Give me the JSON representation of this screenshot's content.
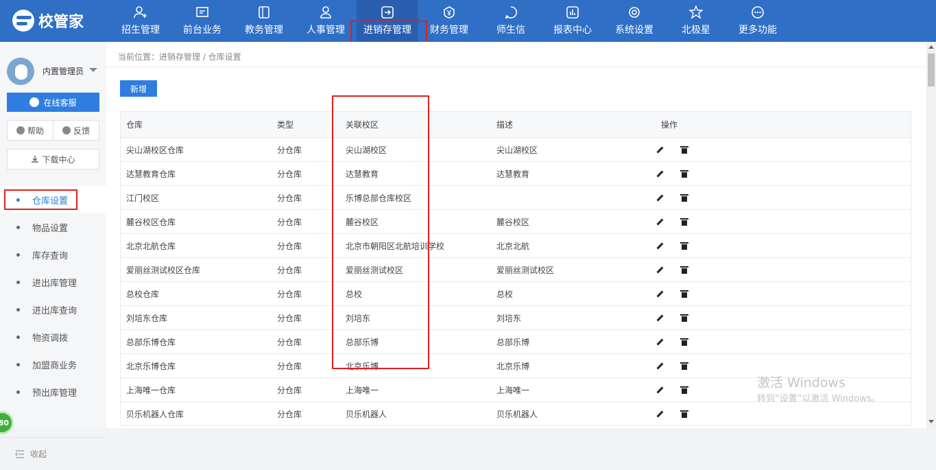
{
  "app": {
    "logo_text": "校管家"
  },
  "nav": [
    {
      "label": "招生管理",
      "icon": "user-plus-icon"
    },
    {
      "label": "前台业务",
      "icon": "monitor-icon"
    },
    {
      "label": "教务管理",
      "icon": "book-icon"
    },
    {
      "label": "人事管理",
      "icon": "person-icon"
    },
    {
      "label": "进销存管理",
      "icon": "arrow-box-icon",
      "active": true
    },
    {
      "label": "财务管理",
      "icon": "yen-shield-icon"
    },
    {
      "label": "师生信",
      "icon": "message-icon"
    },
    {
      "label": "报表中心",
      "icon": "bar-report-icon"
    },
    {
      "label": "系统设置",
      "icon": "gear-icon"
    },
    {
      "label": "北极星",
      "icon": "star-icon"
    },
    {
      "label": "更多功能",
      "icon": "more-icon"
    }
  ],
  "sidebar": {
    "user_name": "内置管理员",
    "online_service": "在线客服",
    "help": "帮助",
    "feedback": "反馈",
    "download": "下载中心",
    "menu": [
      "仓库设置",
      "物品设置",
      "库存查询",
      "进出库管理",
      "进出库查询",
      "物资调拨",
      "加盟商业务",
      "预出库管理"
    ],
    "active_index": 0,
    "score": "80",
    "collapse": "收起"
  },
  "breadcrumb": "当前位置：进销存管理 / 仓库设置",
  "add_button": "新增",
  "table": {
    "headers": [
      "仓库",
      "类型",
      "关联校区",
      "描述",
      "操作"
    ],
    "rows": [
      [
        "尖山湖校区仓库",
        "分仓库",
        "尖山湖校区",
        "尖山湖校区"
      ],
      [
        "达慧教育仓库",
        "分仓库",
        "达慧教育",
        "达慧教育"
      ],
      [
        "江门校区",
        "分仓库",
        "乐博总部仓库校区",
        ""
      ],
      [
        "麓谷校区仓库",
        "分仓库",
        "麓谷校区",
        "麓谷校区"
      ],
      [
        "北京北航仓库",
        "分仓库",
        "北京市朝阳区北航培训学校",
        "北京北航"
      ],
      [
        "爱丽丝测试校区仓库",
        "分仓库",
        "爱丽丝测试校区",
        "爱丽丝测试校区"
      ],
      [
        "总校仓库",
        "分仓库",
        "总校",
        "总校"
      ],
      [
        "刘培东仓库",
        "分仓库",
        "刘培东",
        "刘培东"
      ],
      [
        "总部乐博仓库",
        "分仓库",
        "总部乐博",
        "总部乐博"
      ],
      [
        "北京乐博仓库",
        "分仓库",
        "北京乐博",
        "北京乐博"
      ],
      [
        "上海唯一仓库",
        "分仓库",
        "上海唯一",
        "上海唯一"
      ],
      [
        "贝乐机器人仓库",
        "分仓库",
        "贝乐机器人",
        "贝乐机器人"
      ]
    ]
  },
  "watermark": {
    "line1": "激活 Windows",
    "line2": "转到“设置”以激活 Windows。"
  },
  "colors": {
    "primary": "#2f7de1",
    "topbar": "#2f6fc6",
    "highlight": "#e02020"
  }
}
